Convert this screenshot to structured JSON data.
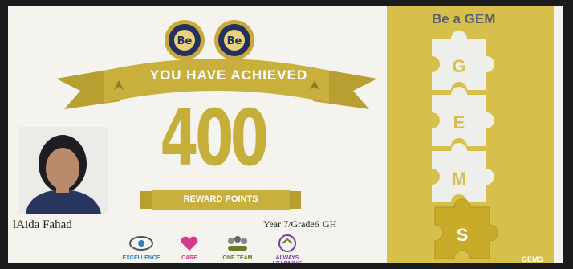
{
  "brand": {
    "logo_text": "Be a GEM",
    "footer_text": "GEMS"
  },
  "achievement": {
    "headline": "YOU HAVE ACHIEVED",
    "points": "400",
    "points_label": "REWARD POINTS"
  },
  "student": {
    "name": "lAida Fahad",
    "grade": "Year 7/Grade6",
    "house": "GH"
  },
  "values": [
    {
      "label": "EXCELLENCE",
      "color": "#2e7fc0",
      "icon": "eye-icon"
    },
    {
      "label": "CARE",
      "color": "#d33a8b",
      "icon": "heart-hands-icon"
    },
    {
      "label": "ONE TEAM",
      "color": "#6a7c2a",
      "icon": "team-icon"
    },
    {
      "label": "ALWAYS LEARNING",
      "color": "#7a3aa0",
      "icon": "learning-icon"
    }
  ],
  "puzzle_letters": [
    "G",
    "E",
    "M",
    "S"
  ],
  "colors": {
    "gold": "#c5ae3a",
    "panel": "#d6bf4a",
    "medal_navy": "#24305e"
  }
}
